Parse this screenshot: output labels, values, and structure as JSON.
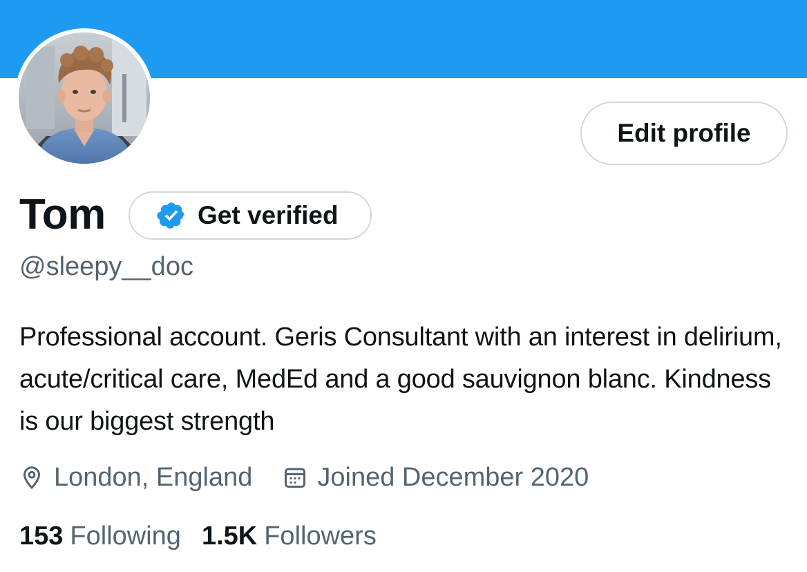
{
  "theme": {
    "accent": "#1d9bf0",
    "text_primary": "#0f1419",
    "text_secondary": "#536471",
    "border": "#cfd9de"
  },
  "profile": {
    "name": "Tom",
    "handle": "@sleepy__doc",
    "bio": "Professional account. Geris Consultant with an interest in delirium, acute/critical care, MedEd and a good sauvignon blanc. Kindness is our biggest strength",
    "avatar_icon": "profile-photo"
  },
  "buttons": {
    "edit_profile": "Edit profile",
    "get_verified": "Get verified",
    "verified_icon": "verified-badge-icon"
  },
  "meta": {
    "location": "London, England",
    "location_icon": "location-pin-icon",
    "joined": "Joined December 2020",
    "joined_icon": "calendar-icon"
  },
  "stats": {
    "following_count": "153",
    "following_label": "Following",
    "followers_count": "1.5K",
    "followers_label": "Followers"
  }
}
